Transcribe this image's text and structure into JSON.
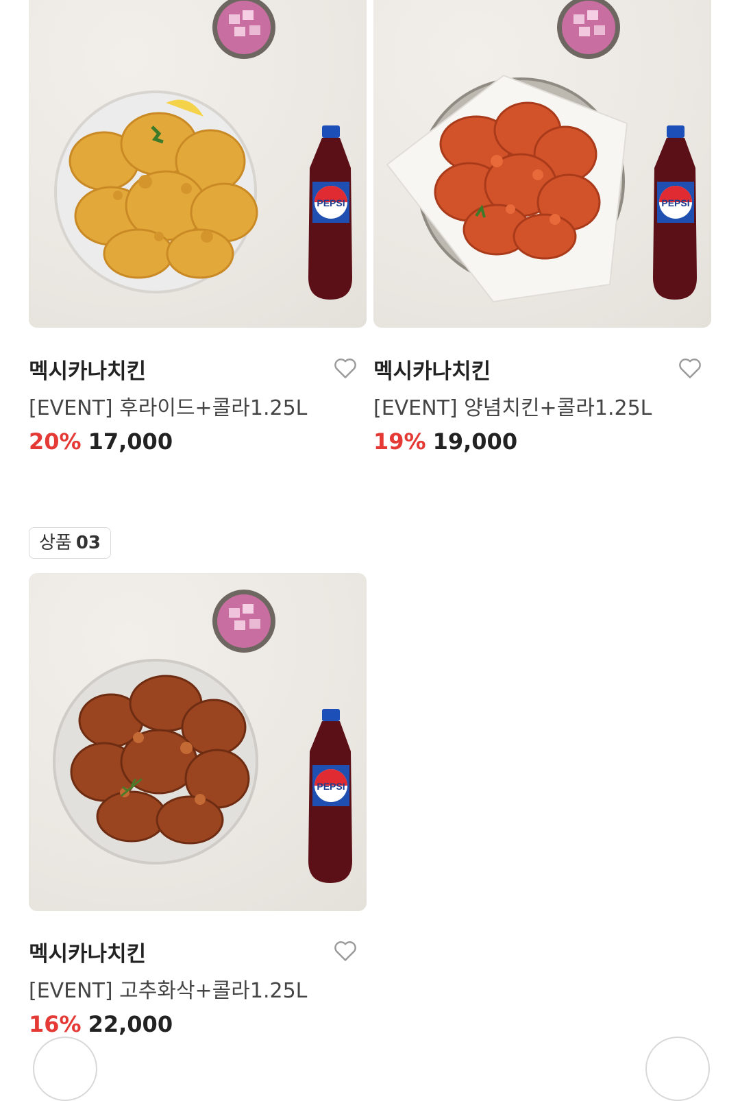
{
  "products": [
    {
      "brand": "멕시카나치킨",
      "title": "[EVENT] 후라이드+콜라1.25L",
      "discount": "20%",
      "price": "17,000",
      "chicken_color": "#e3a83a",
      "bottle_label": "PEPSI"
    },
    {
      "brand": "멕시카나치킨",
      "title": "[EVENT] 양념치킨+콜라1.25L",
      "discount": "19%",
      "price": "19,000",
      "chicken_color": "#d2532a",
      "bottle_label": "PEPSI"
    },
    {
      "brand": "멕시카나치킨",
      "title": "[EVENT] 고추화삭+콜라1.25L",
      "discount": "16%",
      "price": "22,000",
      "chicken_color": "#9a4420",
      "bottle_label": "PEPSI"
    }
  ],
  "section_badge": {
    "label": "상품",
    "number": "03"
  },
  "colors": {
    "discount": "#e53935",
    "text": "#222222"
  },
  "icons": [
    "heart-outline-icon",
    "chicken-plate-image",
    "pepsi-bottle-image",
    "pickled-radish-bowl-image"
  ]
}
